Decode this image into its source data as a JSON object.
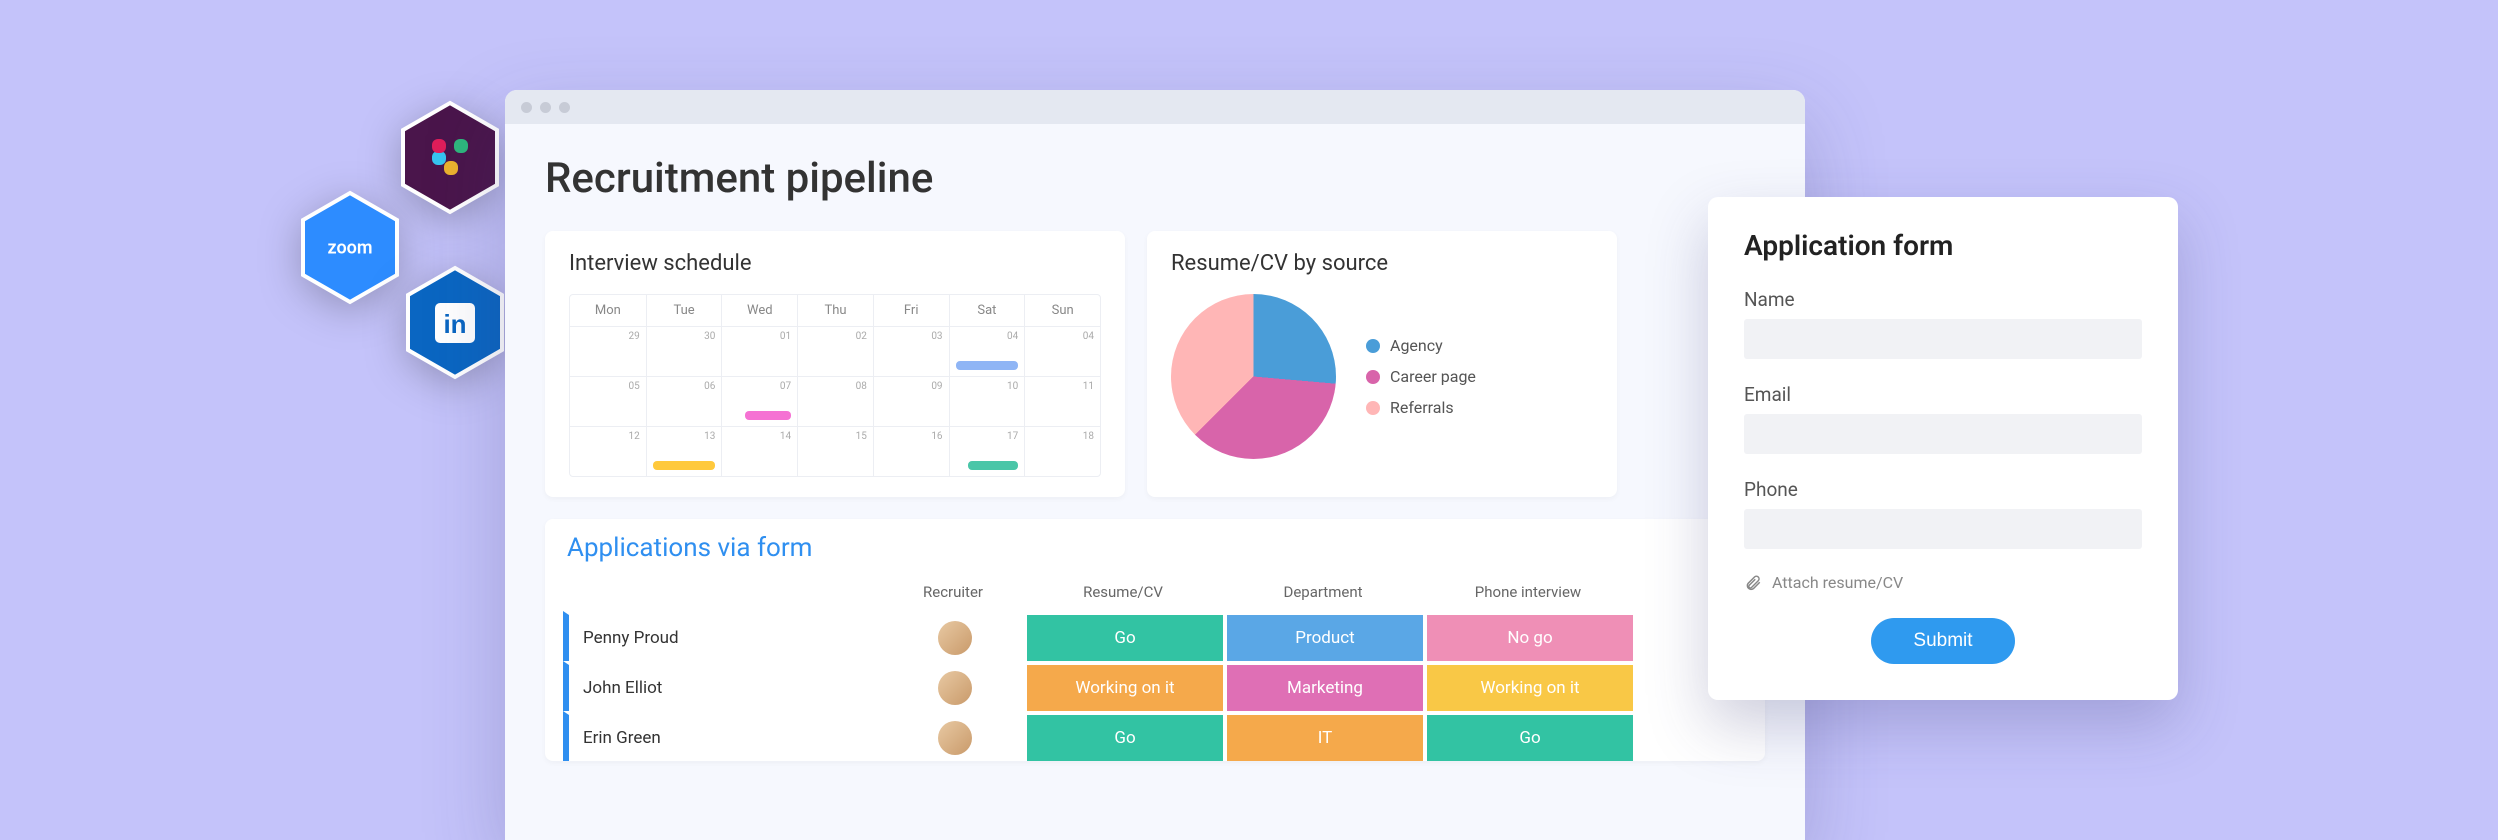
{
  "integrations": {
    "slack": {
      "name": "slack",
      "brand": "#4a154b"
    },
    "zoom": {
      "name": "zoom",
      "brand": "#2d8cff",
      "label": "zoom"
    },
    "linkedin": {
      "name": "linkedin",
      "brand": "#0a66c2"
    }
  },
  "page": {
    "title": "Recruitment pipeline"
  },
  "schedule": {
    "title": "Interview schedule",
    "days": [
      "Mon",
      "Tue",
      "Wed",
      "Thu",
      "Fri",
      "Sat",
      "Sun"
    ],
    "weeks": [
      [
        {
          "n": "29"
        },
        {
          "n": "30"
        },
        {
          "n": "01"
        },
        {
          "n": "02"
        },
        {
          "n": "03"
        },
        {
          "n": "04",
          "ev": "blue"
        },
        {
          "n": "04"
        }
      ],
      [
        {
          "n": "05"
        },
        {
          "n": "06"
        },
        {
          "n": "07",
          "ev": "pink"
        },
        {
          "n": "08"
        },
        {
          "n": "09"
        },
        {
          "n": "10"
        },
        {
          "n": "11"
        }
      ],
      [
        {
          "n": "12"
        },
        {
          "n": "13",
          "ev": "yellow"
        },
        {
          "n": "14"
        },
        {
          "n": "15"
        },
        {
          "n": "16"
        },
        {
          "n": "17",
          "ev": "teal"
        },
        {
          "n": "18"
        }
      ]
    ]
  },
  "sources": {
    "title": "Resume/CV by source",
    "legend": [
      {
        "label": "Agency",
        "color": "#4a9dd8"
      },
      {
        "label": "Career page",
        "color": "#d864aa"
      },
      {
        "label": "Referrals",
        "color": "#ffb6b6"
      }
    ]
  },
  "chart_data": {
    "type": "pie",
    "title": "Resume/CV by source",
    "series": [
      {
        "name": "Agency",
        "value": 26,
        "color": "#4a9dd8"
      },
      {
        "name": "Career page",
        "value": 36,
        "color": "#d864aa"
      },
      {
        "name": "Referrals",
        "value": 38,
        "color": "#ffb6b6"
      }
    ]
  },
  "applications": {
    "title": "Applications via form",
    "columns": [
      "",
      "Recruiter",
      "Resume/CV",
      "Department",
      "Phone interview"
    ],
    "rows": [
      {
        "name": "Penny Proud",
        "resume": {
          "label": "Go",
          "cls": "pill-teal"
        },
        "dept": {
          "label": "Product",
          "cls": "pill-blue"
        },
        "phone": {
          "label": "No go",
          "cls": "pill-pink"
        }
      },
      {
        "name": "John Elliot",
        "resume": {
          "label": "Working on it",
          "cls": "pill-orange"
        },
        "dept": {
          "label": "Marketing",
          "cls": "pill-mag"
        },
        "phone": {
          "label": "Working on it",
          "cls": "pill-yellow"
        }
      },
      {
        "name": "Erin Green",
        "resume": {
          "label": "Go",
          "cls": "pill-teal"
        },
        "dept": {
          "label": "IT",
          "cls": "pill-orange"
        },
        "phone": {
          "label": "Go",
          "cls": "pill-teal"
        }
      }
    ]
  },
  "form": {
    "title": "Application form",
    "fields": {
      "name": "Name",
      "email": "Email",
      "phone": "Phone"
    },
    "attach": "Attach resume/CV",
    "submit": "Submit"
  }
}
